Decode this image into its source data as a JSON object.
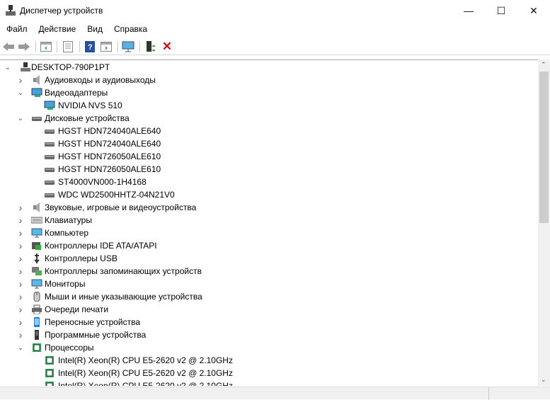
{
  "window": {
    "title": "Диспетчер устройств",
    "minimize": "—",
    "maximize": "☐",
    "close": "✕"
  },
  "menu": [
    "Файл",
    "Действие",
    "Вид",
    "Справка"
  ],
  "toolbar": [
    "back",
    "forward",
    "properties-panel",
    "details",
    "help",
    "view-panel",
    "monitor-scan",
    "enable-driver",
    "uninstall"
  ],
  "tree": [
    {
      "level": 0,
      "label": "DESKTOP-790P1PT",
      "expanded": true,
      "icon": "computer-icon"
    },
    {
      "level": 1,
      "label": "Аудиовходы и аудиовыходы",
      "expanded": false,
      "icon": "speaker-icon"
    },
    {
      "level": 1,
      "label": "Видеоадаптеры",
      "expanded": true,
      "icon": "display-adapter-icon"
    },
    {
      "level": 2,
      "label": "NVIDIA NVS 510",
      "icon": "display-adapter-icon"
    },
    {
      "level": 1,
      "label": "Дисковые устройства",
      "expanded": true,
      "icon": "disk-icon"
    },
    {
      "level": 2,
      "label": "HGST HDN724040ALE640",
      "icon": "disk-icon"
    },
    {
      "level": 2,
      "label": "HGST HDN724040ALE640",
      "icon": "disk-icon"
    },
    {
      "level": 2,
      "label": "HGST HDN726050ALE610",
      "icon": "disk-icon"
    },
    {
      "level": 2,
      "label": "HGST HDN726050ALE610",
      "icon": "disk-icon"
    },
    {
      "level": 2,
      "label": "ST4000VN000-1H4168",
      "icon": "disk-icon"
    },
    {
      "level": 2,
      "label": "WDC WD2500HHTZ-04N21V0",
      "icon": "disk-icon"
    },
    {
      "level": 1,
      "label": "Звуковые, игровые и видеоустройства",
      "expanded": false,
      "icon": "speaker-icon"
    },
    {
      "level": 1,
      "label": "Клавиатуры",
      "expanded": false,
      "icon": "keyboard-icon"
    },
    {
      "level": 1,
      "label": "Компьютер",
      "expanded": false,
      "icon": "monitor-icon"
    },
    {
      "level": 1,
      "label": "Контроллеры IDE ATA/ATAPI",
      "expanded": false,
      "icon": "controller-icon"
    },
    {
      "level": 1,
      "label": "Контроллеры USB",
      "expanded": false,
      "icon": "usb-icon"
    },
    {
      "level": 1,
      "label": "Контроллеры запоминающих устройств",
      "expanded": false,
      "icon": "storage-controller-icon"
    },
    {
      "level": 1,
      "label": "Мониторы",
      "expanded": false,
      "icon": "monitor-icon"
    },
    {
      "level": 1,
      "label": "Мыши и иные указывающие устройства",
      "expanded": false,
      "icon": "mouse-icon"
    },
    {
      "level": 1,
      "label": "Очереди печати",
      "expanded": false,
      "icon": "printer-icon"
    },
    {
      "level": 1,
      "label": "Переносные устройства",
      "expanded": false,
      "icon": "portable-device-icon"
    },
    {
      "level": 1,
      "label": "Программные устройства",
      "expanded": false,
      "icon": "software-device-icon"
    },
    {
      "level": 1,
      "label": "Процессоры",
      "expanded": true,
      "icon": "processor-icon"
    },
    {
      "level": 2,
      "label": "Intel(R) Xeon(R) CPU E5-2620 v2 @ 2.10GHz",
      "icon": "processor-icon"
    },
    {
      "level": 2,
      "label": "Intel(R) Xeon(R) CPU E5-2620 v2 @ 2.10GHz",
      "icon": "processor-icon"
    },
    {
      "level": 2,
      "label": "Intel(R) Xeon(R) CPU E5-2620 v2 @ 2.10GHz",
      "icon": "processor-icon"
    }
  ]
}
